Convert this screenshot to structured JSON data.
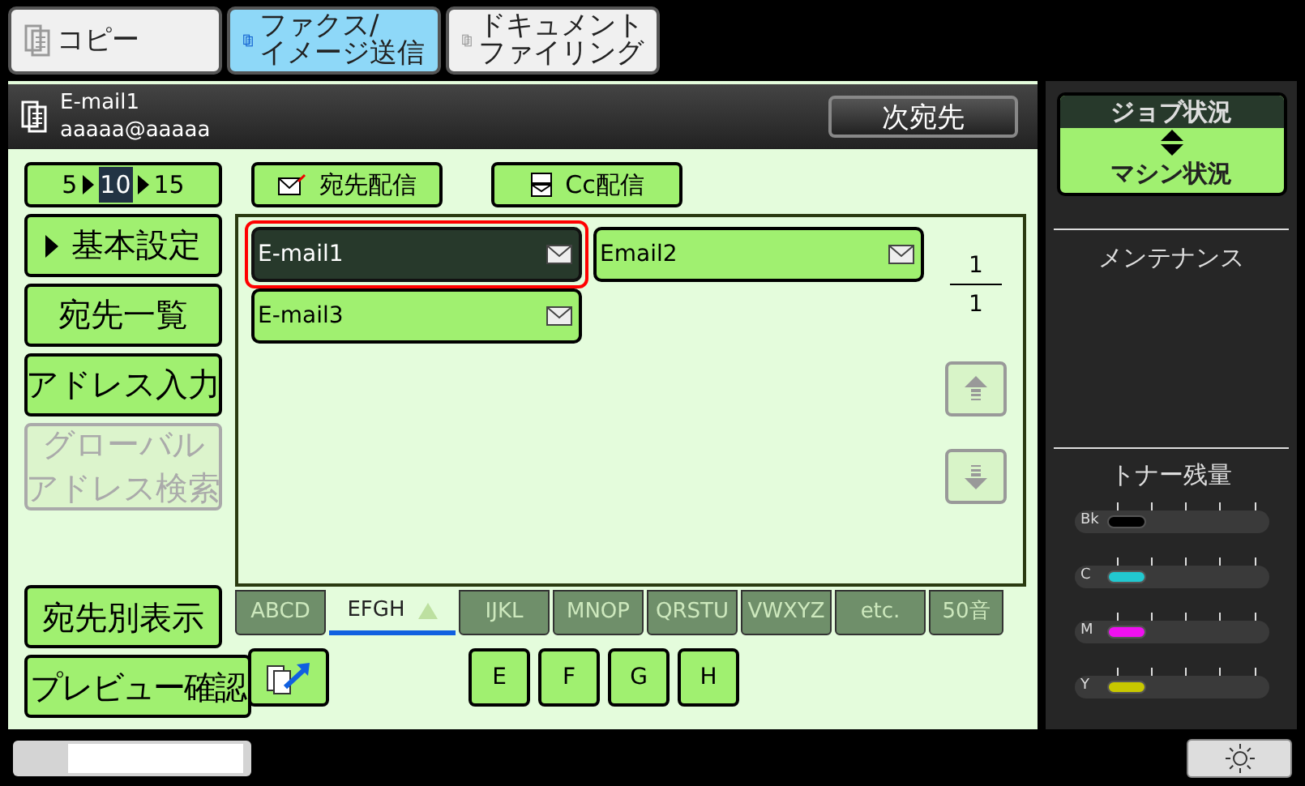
{
  "tabs": [
    {
      "lines": [
        "コピー"
      ],
      "selected": false
    },
    {
      "lines": [
        "ファクス/",
        "イメージ送信"
      ],
      "selected": true
    },
    {
      "lines": [
        "ドキュメント",
        "ファイリング"
      ],
      "selected": false
    }
  ],
  "header": {
    "name": "E-mail1",
    "address": "aaaaa@aaaaa",
    "next_button": "次宛先"
  },
  "count_selector": [
    {
      "label": "5",
      "selected": false
    },
    {
      "label": "10",
      "selected": true
    },
    {
      "label": "15",
      "selected": false
    }
  ],
  "mode_buttons": [
    {
      "label": "宛先配信",
      "kind": "to"
    },
    {
      "label": "Cc配信",
      "kind": "cc"
    }
  ],
  "side_buttons": [
    {
      "lines": [
        "基本設定"
      ],
      "kind": "menu",
      "disabled": false
    },
    {
      "lines": [
        "宛先一覧"
      ],
      "kind": "plain",
      "disabled": false
    },
    {
      "lines": [
        "アドレス入力"
      ],
      "kind": "plain",
      "disabled": false
    },
    {
      "lines": [
        "グローバル",
        "アドレス検索"
      ],
      "kind": "plain",
      "disabled": true
    }
  ],
  "addresses": [
    {
      "label": "E-mail1",
      "selected": true
    },
    {
      "label": "Email2",
      "selected": false
    },
    {
      "label": "E-mail3",
      "selected": false
    }
  ],
  "page": {
    "current": "1",
    "total": "1"
  },
  "scroll_buttons": [
    {
      "kind": "up",
      "disabled": true
    },
    {
      "kind": "down",
      "disabled": true
    }
  ],
  "index_tabs": [
    {
      "label": "ABCD",
      "selected": false
    },
    {
      "label": "EFGH",
      "selected": true
    },
    {
      "label": "IJKL",
      "selected": false
    },
    {
      "label": "MNOP",
      "selected": false
    },
    {
      "label": "QRSTU",
      "selected": false
    },
    {
      "label": "VWXYZ",
      "selected": false
    },
    {
      "label": "etc.",
      "selected": false
    },
    {
      "label": "50音",
      "selected": false
    }
  ],
  "bottom_buttons": [
    {
      "label": "宛先別表示"
    },
    {
      "label": "プレビュー確認"
    }
  ],
  "letters": [
    "E",
    "F",
    "G",
    "H"
  ],
  "status_button": {
    "top": "ジョブ状況",
    "bottom": "マシン状況"
  },
  "maintenance": "メンテナンス",
  "toner": {
    "title": "トナー残量",
    "colors": [
      {
        "label": "Bk",
        "color": "#000000",
        "level": 0.25
      },
      {
        "label": "C",
        "color": "#22c8d0",
        "level": 0.25
      },
      {
        "label": "M",
        "color": "#f010f0",
        "level": 0.25
      },
      {
        "label": "Y",
        "color": "#c8c800",
        "level": 0.25
      }
    ]
  }
}
